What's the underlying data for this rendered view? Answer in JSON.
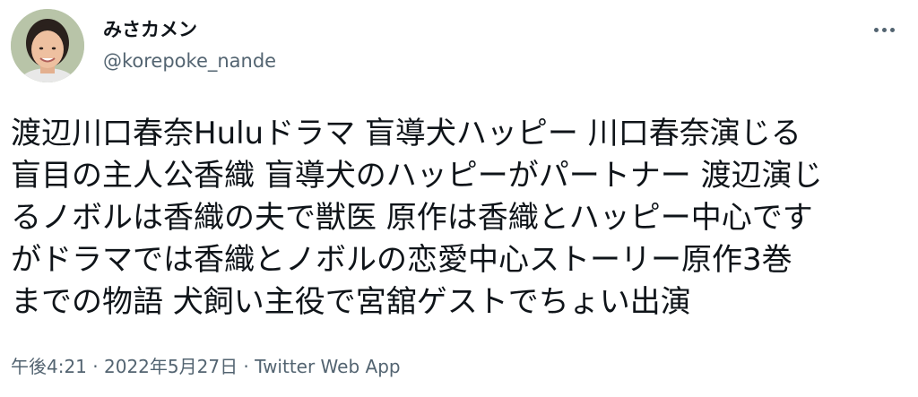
{
  "user": {
    "display_name": "みさカメン",
    "handle": "@korepoke_nande"
  },
  "more_icon": "more-horizontal-icon",
  "tweet": {
    "lines": [
      "渡辺川口春奈Huluドラマ 盲導犬ハッピー 川口春奈演じる",
      "盲目の主人公香織 盲導犬のハッピーがパートナー 渡辺演じ",
      "るノボルは香織の夫で獣医 原作は香織とハッピー中心です",
      "がドラマでは香織とノボルの恋愛中心ストーリー原作3巻",
      "までの物語 犬飼い主役で宮舘ゲストでちょい出演"
    ]
  },
  "meta": {
    "time": "午後4:21",
    "separator1": " · ",
    "date": "2022年5月27日",
    "separator2": " · ",
    "source": "Twitter Web App"
  },
  "colors": {
    "text": "#0f1419",
    "secondary": "#536471",
    "background": "#ffffff"
  }
}
